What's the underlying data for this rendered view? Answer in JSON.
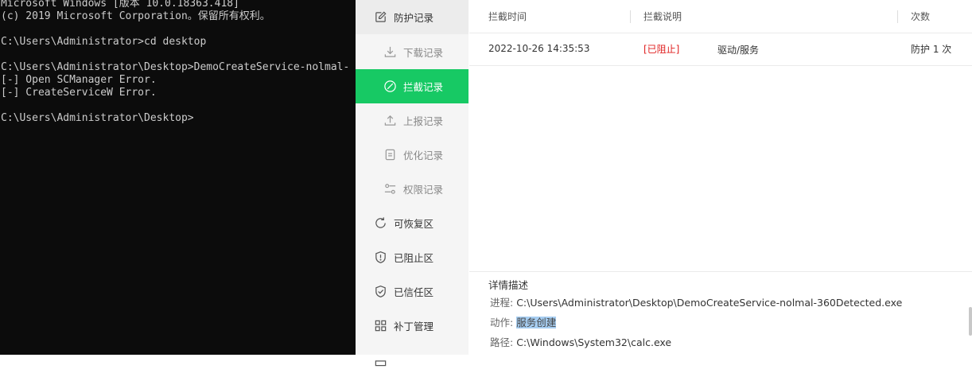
{
  "console": {
    "lines": [
      "Microsoft Windows [版本 10.0.18363.418]",
      "(c) 2019 Microsoft Corporation。保留所有权利。",
      "",
      "C:\\Users\\Administrator>cd desktop",
      "",
      "C:\\Users\\Administrator\\Desktop>DemoCreateService-nolmal-",
      "[-] Open SCManager Error.",
      "[-] CreateServiceW Error.",
      "",
      "C:\\Users\\Administrator\\Desktop>"
    ]
  },
  "sidebar": {
    "items": [
      {
        "label": "防护记录",
        "icon": "edit-icon"
      },
      {
        "label": "下载记录",
        "icon": "download-icon"
      },
      {
        "label": "拦截记录",
        "icon": "block-icon"
      },
      {
        "label": "上报记录",
        "icon": "upload-icon"
      },
      {
        "label": "优化记录",
        "icon": "list-icon"
      },
      {
        "label": "权限记录",
        "icon": "sliders-icon"
      },
      {
        "label": "可恢复区",
        "icon": "restore-icon"
      },
      {
        "label": "已阻止区",
        "icon": "shield-icon"
      },
      {
        "label": "已信任区",
        "icon": "shield-check-icon"
      },
      {
        "label": "补丁管理",
        "icon": "grid-icon"
      }
    ]
  },
  "table": {
    "headers": [
      "拦截时间",
      "拦截说明",
      "次数"
    ],
    "rows": [
      {
        "time": "2022-10-26 14:35:53",
        "status": "[已阻止]",
        "desc": "驱动/服务",
        "count": "防护 1 次"
      }
    ]
  },
  "detail": {
    "title": "详情描述",
    "process_label": "进程:",
    "process_value": "C:\\Users\\Administrator\\Desktop\\DemoCreateService-nolmal-360Detected.exe",
    "action_label": "动作:",
    "action_value": "服务创建",
    "path_label": "路径:",
    "path_value": "C:\\Windows\\System32\\calc.exe"
  },
  "colors": {
    "active": "#17c964",
    "blocked": "#e02020"
  }
}
